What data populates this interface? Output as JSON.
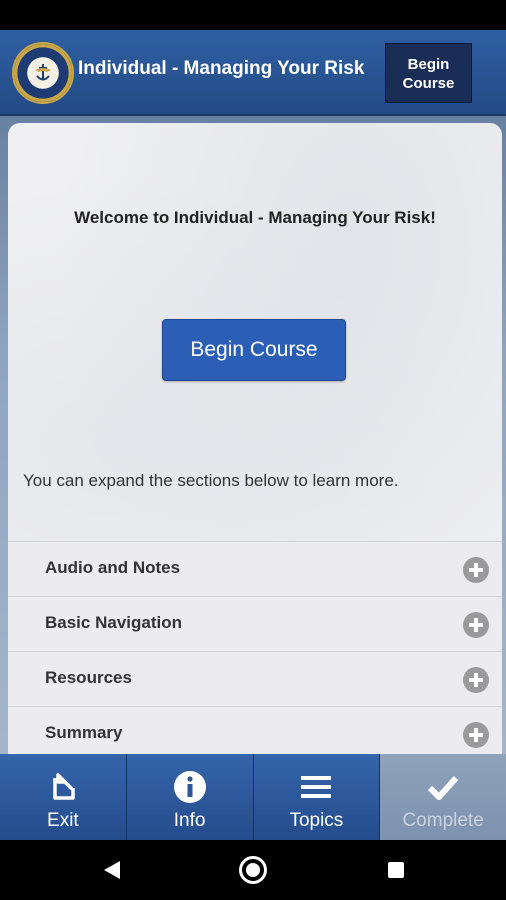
{
  "header": {
    "title": "Individual - Managing Your Risk",
    "begin_line1": "Begin",
    "begin_line2": "Course"
  },
  "main": {
    "welcome": "Welcome to Individual - Managing Your Risk!",
    "begin_button": "Begin Course",
    "hint": "You can expand the sections below to learn more.",
    "sections": [
      {
        "label": "Audio and Notes",
        "icon": "plus-circle-icon"
      },
      {
        "label": "Basic Navigation",
        "icon": "plus-circle-icon"
      },
      {
        "label": "Resources",
        "icon": "plus-circle-icon"
      },
      {
        "label": "Summary",
        "icon": "plus-circle-icon"
      }
    ]
  },
  "tabbar": {
    "tabs": [
      {
        "label": "Exit",
        "icon": "exit-icon"
      },
      {
        "label": "Info",
        "icon": "info-icon"
      },
      {
        "label": "Topics",
        "icon": "menu-icon"
      },
      {
        "label": "Complete",
        "icon": "checkmark-icon"
      }
    ]
  },
  "colors": {
    "header": "#2f5fa3",
    "begin_button": "#2b5fb5",
    "header_begin": "#1a2d57",
    "tab_active": "#3565aa",
    "tab_disabled": "#8fa2bb"
  }
}
